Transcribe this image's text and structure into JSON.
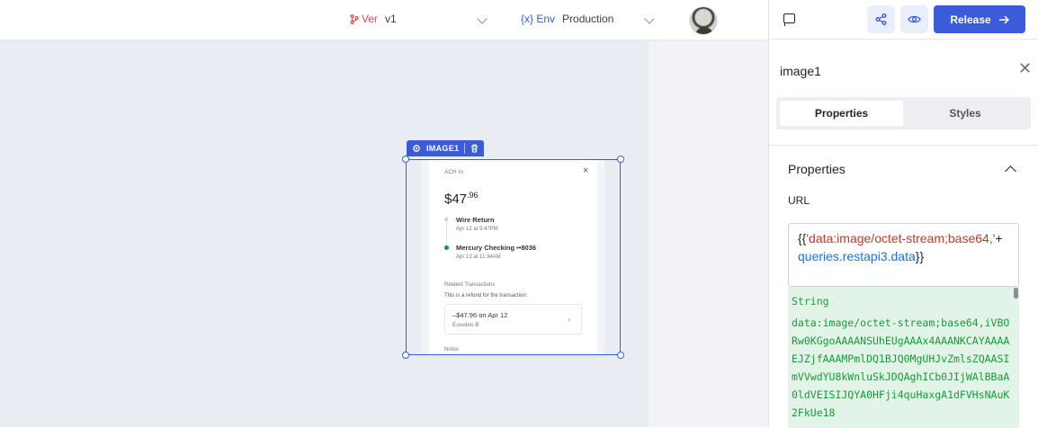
{
  "topbar": {
    "version_tag": "Ver",
    "version_value": "v1",
    "env_tag": "{x} Env",
    "env_value": "Production"
  },
  "canvas": {
    "component_label": "IMAGE1",
    "image_content": {
      "header": "ACH In",
      "amount_main": "$47",
      "amount_cents": ".96",
      "events": [
        {
          "title": "Wire Return",
          "date": "Apr 12 at 9:47PM"
        },
        {
          "title": "Mercury Checking ••8036",
          "date": "Apr 13 at 11:34AM"
        }
      ],
      "related_title": "Related Transactions",
      "refund_text": "This is a refund for the transaction:",
      "related_amount": "–$47.96 on Apr 12",
      "related_name": "Eusebio B",
      "notes": "Notes"
    }
  },
  "panel": {
    "release_label": "Release",
    "component_name": "image1",
    "tabs": [
      "Properties",
      "Styles"
    ],
    "section_title": "Properties",
    "url_label": "URL",
    "url_code": {
      "open": "{{",
      "string": "'data:image/octet-stream;base64,'",
      "op": "+",
      "var": "queries.restapi3.data",
      "close": "}}"
    },
    "preview_type": "String",
    "preview_value": "data:image/octet-stream;base64,iVBORw0KGgoAAAANSUhEUgAAAx4AAANKCAYAAAAEJZjfAAAMPmlDQ1BJQ0MgUHJvZmlsZQAASImVVwdYU8kWnluSkJDQAghICb0JIjWAlBBaA0ldVEISIJQYA0HFji4quHaxgA1dFVHsNAuK2FkUe18"
  }
}
